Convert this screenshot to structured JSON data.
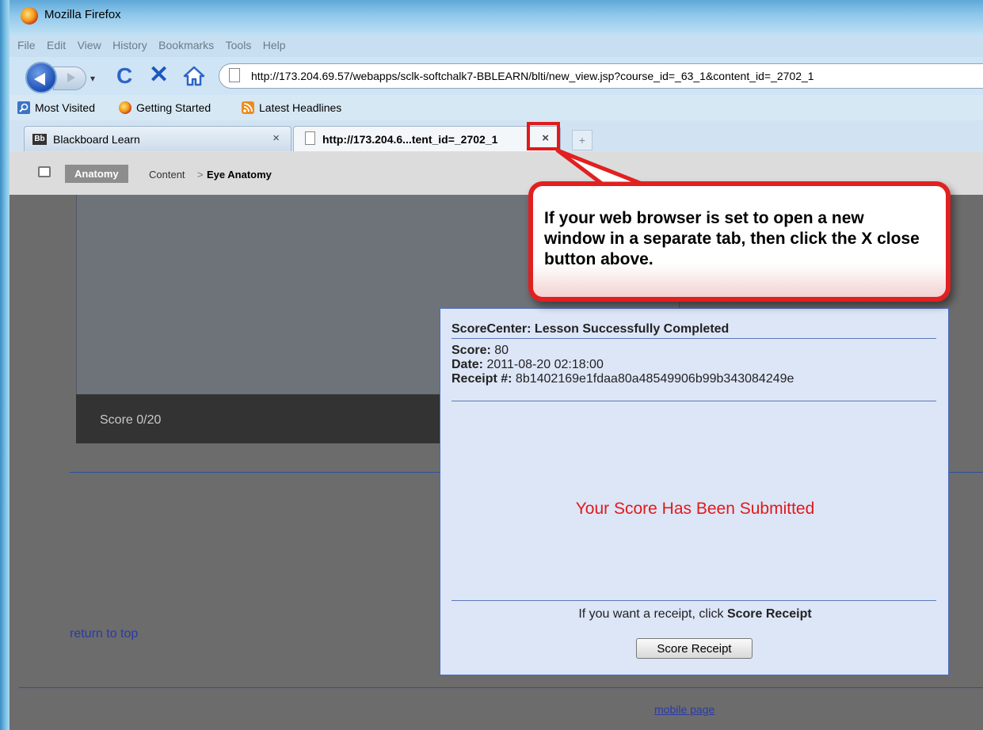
{
  "window": {
    "title": "Mozilla Firefox"
  },
  "menu": {
    "items": [
      "File",
      "Edit",
      "View",
      "History",
      "Bookmarks",
      "Tools",
      "Help"
    ]
  },
  "nav": {
    "url": "http://173.204.69.57/webapps/sclk-softchalk7-BBLEARN/blti/new_view.jsp?course_id=_63_1&content_id=_2702_1"
  },
  "bookmarks": {
    "items": [
      "Most Visited",
      "Getting Started",
      "Latest Headlines"
    ]
  },
  "tabs": [
    {
      "label": "Blackboard Learn",
      "close": "×",
      "icon": "blackboard-icon",
      "icon_text": "Bb"
    },
    {
      "label": "http://173.204.6...tent_id=_2702_1",
      "close": "×",
      "icon": "page-icon"
    }
  ],
  "new_tab_glyph": "+",
  "breadcrumb": {
    "course": "Anatomy",
    "section": "Content",
    "separator": ">",
    "current": "Eye Anatomy"
  },
  "viewer": {
    "score": "Score 0/20"
  },
  "callout": {
    "text": "If your web browser is set to open a new window in a separate tab, then click the X close button above."
  },
  "score_center": {
    "title": "ScoreCenter: Lesson Successfully Completed",
    "score_label": "Score:",
    "score_value": "80",
    "date_label": "Date:",
    "date_value": "2011-08-20 02:18:00",
    "receipt_label": "Receipt #:",
    "receipt_value": "8b1402169e1fdaa80a48549906b99b343084249e",
    "submitted_message": "Your Score Has Been Submitted",
    "receipt_hint_prefix": "If you want a receipt, click",
    "receipt_hint_bold": "Score Receipt",
    "button_label": "Score Receipt"
  },
  "footer": {
    "return_to_top": "return to top",
    "mobile_page": "mobile page"
  },
  "colors": {
    "alert_red": "#e01a1a",
    "panel_bg": "#dde6f7",
    "link_blue": "#2a3aa8"
  }
}
